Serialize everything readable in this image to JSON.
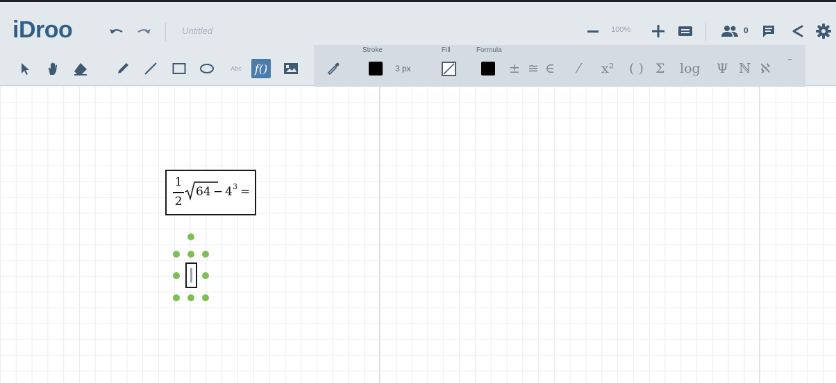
{
  "app": {
    "logo": "iDroo",
    "doc_title": "Untitled"
  },
  "header": {
    "zoom": "100%",
    "user_count": "0"
  },
  "toolbar": {
    "text_tool_label": "Abc",
    "active_tool": "formula"
  },
  "properties": {
    "stroke_label": "Stroke",
    "stroke_width": "3 px",
    "fill_label": "Fill",
    "formula_label": "Formula",
    "stroke_color": "#000000",
    "formula_color": "#000000",
    "symbols": [
      "±",
      "≅",
      "∈",
      "⁄",
      "x²",
      "( )",
      "Σ",
      "log",
      "Ψ",
      "ℕ",
      "ℵ",
      "¯"
    ]
  },
  "canvas": {
    "formula": {
      "numerator": "1",
      "denominator": "2",
      "radicand": "64",
      "minus": "−",
      "base": "4",
      "exponent": "3",
      "equals": "="
    }
  },
  "colors": {
    "accent": "#4a7cab",
    "logo": "#2f5f88",
    "handle": "#7cbf52",
    "toolbar_bg": "#e3e8ed"
  }
}
